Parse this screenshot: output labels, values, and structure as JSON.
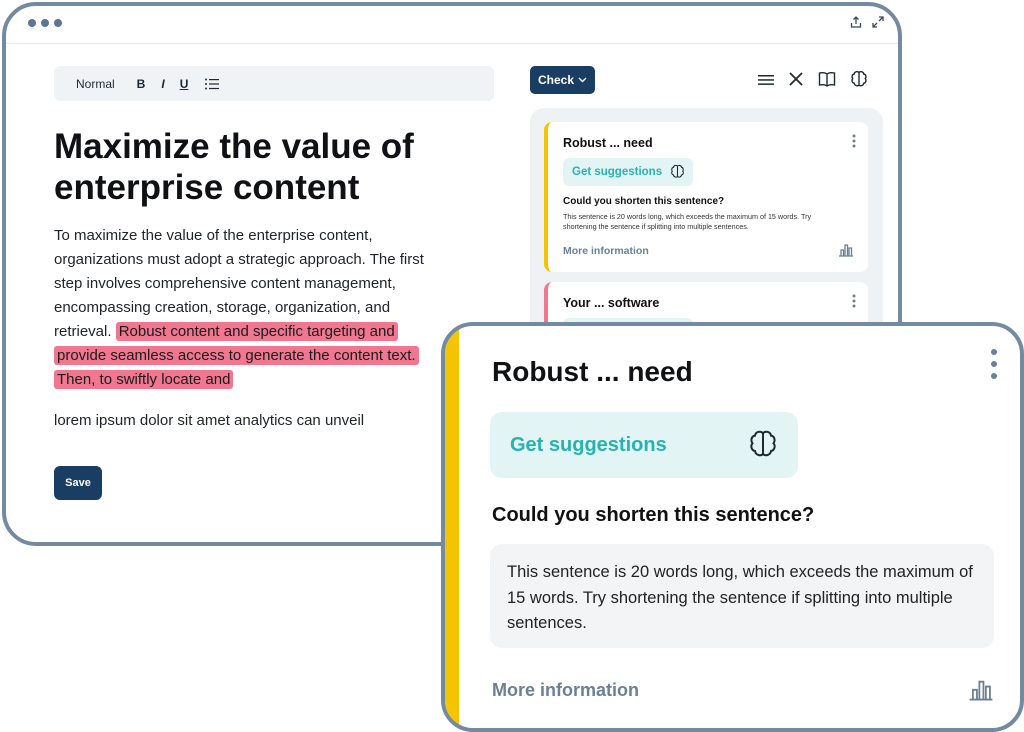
{
  "toolbar": {
    "normal": "Normal",
    "bold": "B",
    "italic": "I",
    "underline": "U"
  },
  "document": {
    "title": "Maximize the value of enterprise content",
    "body_plain": "To maximize the value of the enterprise content, organizations must adopt a strategic approach. The first step involves comprehensive content management, encompassing creation, storage, organization, and retrieval. ",
    "body_highlight": "Robust content and specific targeting and provide seamless access to generate the content text. Then, to swiftly locate and",
    "paragraph2": "lorem ipsum dolor sit amet analytics can unveil",
    "save_label": "Save"
  },
  "panel": {
    "check_label": "Check",
    "cards": [
      {
        "title": "Robust ... need",
        "suggestions_label": "Get suggestions",
        "question": "Could you shorten this sentence?",
        "description": "This sentence is 20 words long, which exceeds the maximum of 15 words. Try shortening the sentence if splitting into multiple sentences.",
        "more_label": "More information",
        "accent": "#f5c400"
      },
      {
        "title": "Your ... software",
        "accent": "#f0778f"
      }
    ]
  },
  "zoom_card": {
    "title": "Robust ... need",
    "suggestions_label": "Get suggestions",
    "question": "Could you shorten this sentence?",
    "description": "This sentence is 20 words long, which exceeds the maximum of 15 words. Try shortening the sentence if splitting into multiple sentences.",
    "more_label": "More information"
  },
  "colors": {
    "primary": "#1a3d63",
    "highlight": "#f0778f",
    "accent_yellow": "#f5c400",
    "teal": "#27b3b0",
    "frame": "#748aa1"
  },
  "icons": [
    "share-icon",
    "expand-icon",
    "list-icon",
    "menu-icon",
    "close-icon",
    "book-icon",
    "brain-icon",
    "kebab-icon",
    "chart-icon",
    "chevron-down-icon"
  ]
}
